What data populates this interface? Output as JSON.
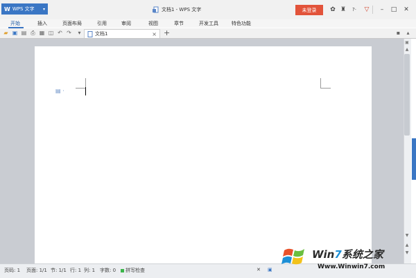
{
  "app": {
    "logo": "W",
    "name": "WPS 文字",
    "window_title": "文档1 - WPS 文字"
  },
  "title_bar": {
    "login_label": "未登录",
    "icons": [
      "skin-icon",
      "shirt-icon",
      "help-icon",
      "feedback-icon",
      "minimize-icon",
      "restore-icon",
      "close-icon"
    ],
    "help_label": "?·"
  },
  "menu": {
    "items": [
      "开始",
      "插入",
      "页面布局",
      "引用",
      "审阅",
      "视图",
      "章节",
      "开发工具",
      "特色功能"
    ],
    "active_index": 0
  },
  "toolbar": {
    "tab_label": "文档1",
    "tab_close": "×",
    "new_tab": "+"
  },
  "status": {
    "page": "页码: 1",
    "pages": "页面: 1/1",
    "section": "节: 1/1",
    "row": "行: 1",
    "col": "列: 1",
    "words": "字数: 0",
    "spell": "拼写检查"
  },
  "watermark": {
    "line1_a": "Win",
    "line1_b": "7",
    "line1_c": "系统之家",
    "line2": "Www.Winwin7.com"
  },
  "colors": {
    "accent": "#3a76c4",
    "login": "#e2533a"
  }
}
